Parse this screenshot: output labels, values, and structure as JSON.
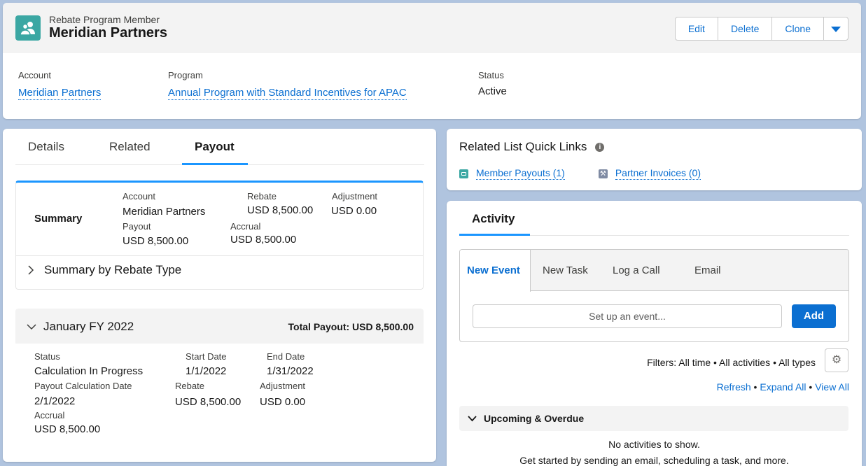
{
  "header": {
    "object_type": "Rebate Program Member",
    "record_name": "Meridian Partners",
    "icon": "partners-icon",
    "actions": [
      "Edit",
      "Delete",
      "Clone"
    ],
    "more_actions_icon": "chevron-down-icon",
    "fields": [
      {
        "label": "Account",
        "value": "Meridian Partners",
        "link": true
      },
      {
        "label": "Program",
        "value": "Annual Program with Standard Incentives for APAC",
        "link": true
      },
      {
        "label": "Status",
        "value": "Active",
        "link": false
      }
    ]
  },
  "tabs": {
    "items": [
      "Details",
      "Related",
      "Payout"
    ],
    "active": "Payout"
  },
  "summary": {
    "title": "Summary",
    "account_label": "Account",
    "account_value": "Meridian Partners",
    "rebate_label": "Rebate",
    "rebate_value": "USD 8,500.00",
    "adjustment_label": "Adjustment",
    "adjustment_value": "USD 0.00",
    "payout_label": "Payout",
    "payout_value": "USD 8,500.00",
    "accrual_label": "Accrual",
    "accrual_value": "USD 8,500.00",
    "by_type_label": "Summary by Rebate Type"
  },
  "period": {
    "title": "January FY 2022",
    "total_payout": "Total Payout: USD 8,500.00",
    "status_label": "Status",
    "status_value": "Calculation In Progress",
    "start_label": "Start Date",
    "start_value": "1/1/2022",
    "end_label": "End Date",
    "end_value": "1/31/2022",
    "calc_date_label": "Payout Calculation Date",
    "calc_date_value": "2/1/2022",
    "rebate_label": "Rebate",
    "rebate_value": "USD 8,500.00",
    "adjustment_label": "Adjustment",
    "adjustment_value": "USD 0.00",
    "accrual_label": "Accrual",
    "accrual_value": "USD 8,500.00"
  },
  "quick_links": {
    "title": "Related List Quick Links",
    "items": [
      {
        "label": "Member Payouts (1)",
        "icon": "payout-icon",
        "color": "#3ba7a3"
      },
      {
        "label": "Partner Invoices (0)",
        "icon": "wrench-icon",
        "color": "#7f8ba3"
      }
    ]
  },
  "activity": {
    "title": "Activity",
    "tabs": [
      "New Event",
      "New Task",
      "Log a Call",
      "Email"
    ],
    "active_tab": "New Event",
    "input_placeholder": "Set up an event...",
    "add_label": "Add",
    "filters": "Filters: All time • All activities • All types",
    "refresh": "Refresh",
    "expand_all": "Expand All",
    "view_all": "View All",
    "upcoming_label": "Upcoming & Overdue",
    "empty_title": "No activities to show.",
    "empty_sub": "Get started by sending an email, scheduling a task, and more."
  },
  "colors": {
    "brand": "#0b6fd1",
    "accent": "#1b96ff"
  }
}
